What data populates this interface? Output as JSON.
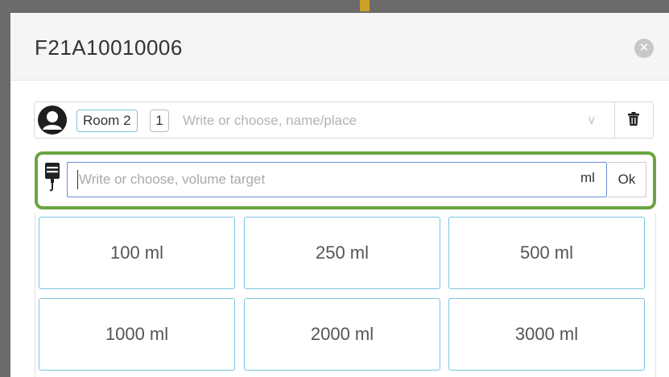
{
  "modal": {
    "title": "F21A10010006"
  },
  "person_row": {
    "room_label": "Room 2",
    "count": "1",
    "placeholder": "Write or choose, name/place"
  },
  "volume_row": {
    "placeholder": "Write or choose, volume target",
    "unit": "ml",
    "ok_label": "Ok"
  },
  "volume_options": [
    "100 ml",
    "250 ml",
    "500 ml",
    "1000 ml",
    "2000 ml",
    "3000 ml"
  ],
  "colors": {
    "highlight_border": "#6aa542",
    "option_border": "#7cc3e0",
    "input_focus_border": "#6b8fd6"
  },
  "icons": {
    "close": "close-icon",
    "avatar": "user-avatar-icon",
    "chevron": "chevron-down-icon",
    "trash": "trash-icon",
    "iv": "iv-bag-icon"
  }
}
